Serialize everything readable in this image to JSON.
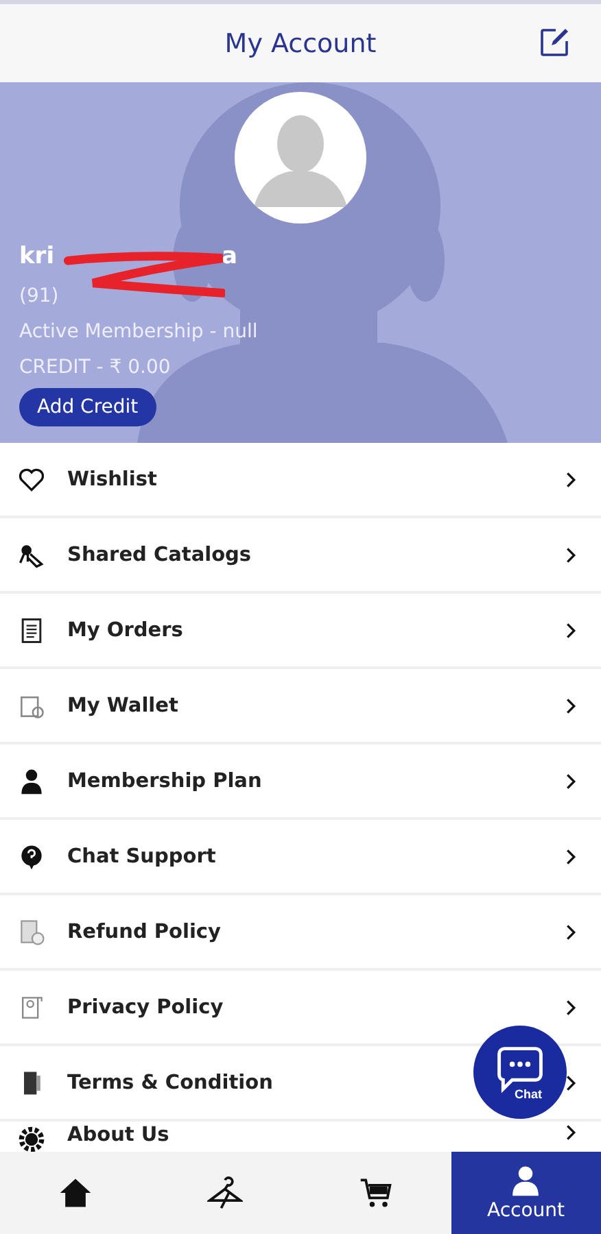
{
  "header": {
    "title": "My Account"
  },
  "profile": {
    "name_start": "kri",
    "name_end": "a",
    "phone_start": "(91)",
    "membership": "Active Membership - null",
    "credit": "CREDIT - ₹ 0.00",
    "add_credit_button": "Add Credit"
  },
  "menu": [
    {
      "label": "Wishlist"
    },
    {
      "label": "Shared Catalogs"
    },
    {
      "label": "My Orders"
    },
    {
      "label": "My Wallet"
    },
    {
      "label": "Membership Plan"
    },
    {
      "label": "Chat Support"
    },
    {
      "label": "Refund Policy"
    },
    {
      "label": "Privacy Policy"
    },
    {
      "label": "Terms & Condition"
    },
    {
      "label": "About Us"
    }
  ],
  "chat_button": {
    "label": "Chat"
  },
  "bottom_nav": [
    {
      "selected": false
    },
    {
      "selected": false
    },
    {
      "selected": false
    },
    {
      "label": "Account",
      "selected": true
    }
  ]
}
